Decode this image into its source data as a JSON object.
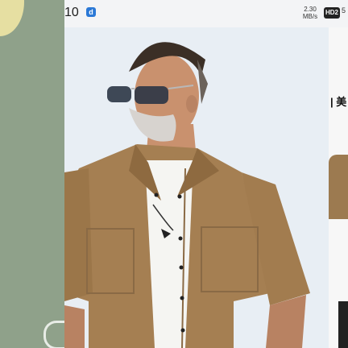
{
  "status_bar": {
    "time": "10",
    "app_badge": "d",
    "net_speed": "2.30 MB/s",
    "hd_badge": "HD2",
    "edge_glyph": "5"
  },
  "right_card": {
    "title_fragment": "| 美"
  },
  "colors": {
    "left_card": "#8fa18a",
    "shirt": "#a57f52",
    "tee": "#f5f5f2",
    "background": "#e8eef4"
  },
  "icons": {
    "app": "blue-app-icon",
    "hd": "hd-badge-icon"
  }
}
